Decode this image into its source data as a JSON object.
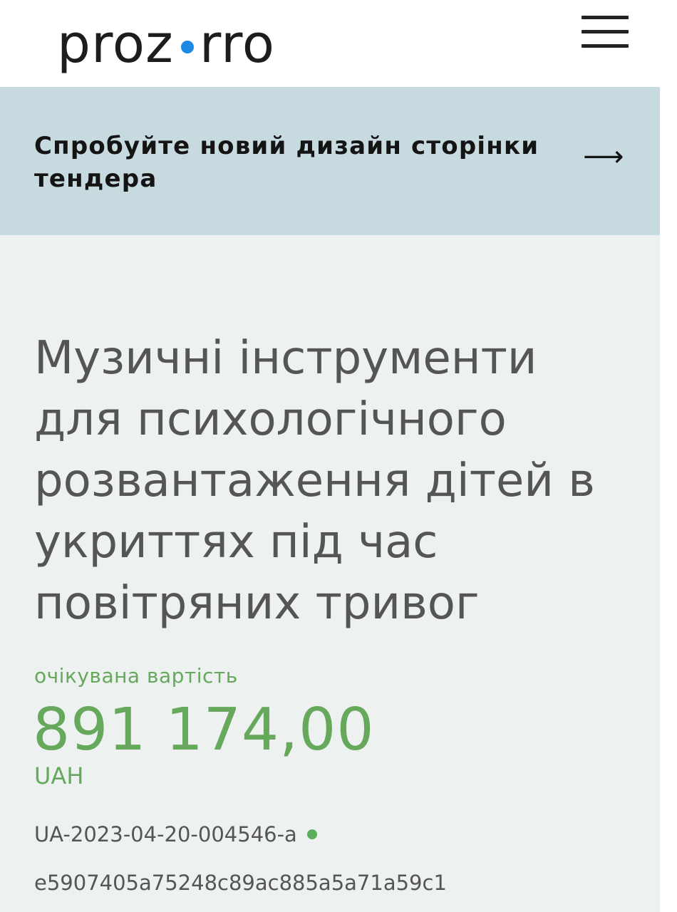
{
  "header": {
    "logo": {
      "left": "proz",
      "right": "rro",
      "dot_color": "#1e88e5"
    },
    "menu_icon": "hamburger-menu-icon"
  },
  "banner": {
    "text": "Спробуйте новий дизайн сторінки тендера",
    "arrow": "⟶",
    "background": "#c7dae0"
  },
  "tender": {
    "title": "Музичні інструменти для психологічного розвантаження дітей в укриттях під час повітряних тривог",
    "expected_value_label": "очікувана вартість",
    "expected_value_amount": "891 174,00",
    "currency": "UAH",
    "tender_id": "UA-2023-04-20-004546-a",
    "hash": "e5907405a75248c89ac885a5a71a59c1"
  },
  "colors": {
    "main_background": "#edf1f0",
    "accent_green": "#66a85c",
    "status_green": "#5cae5c",
    "text_gray": "#555555"
  }
}
